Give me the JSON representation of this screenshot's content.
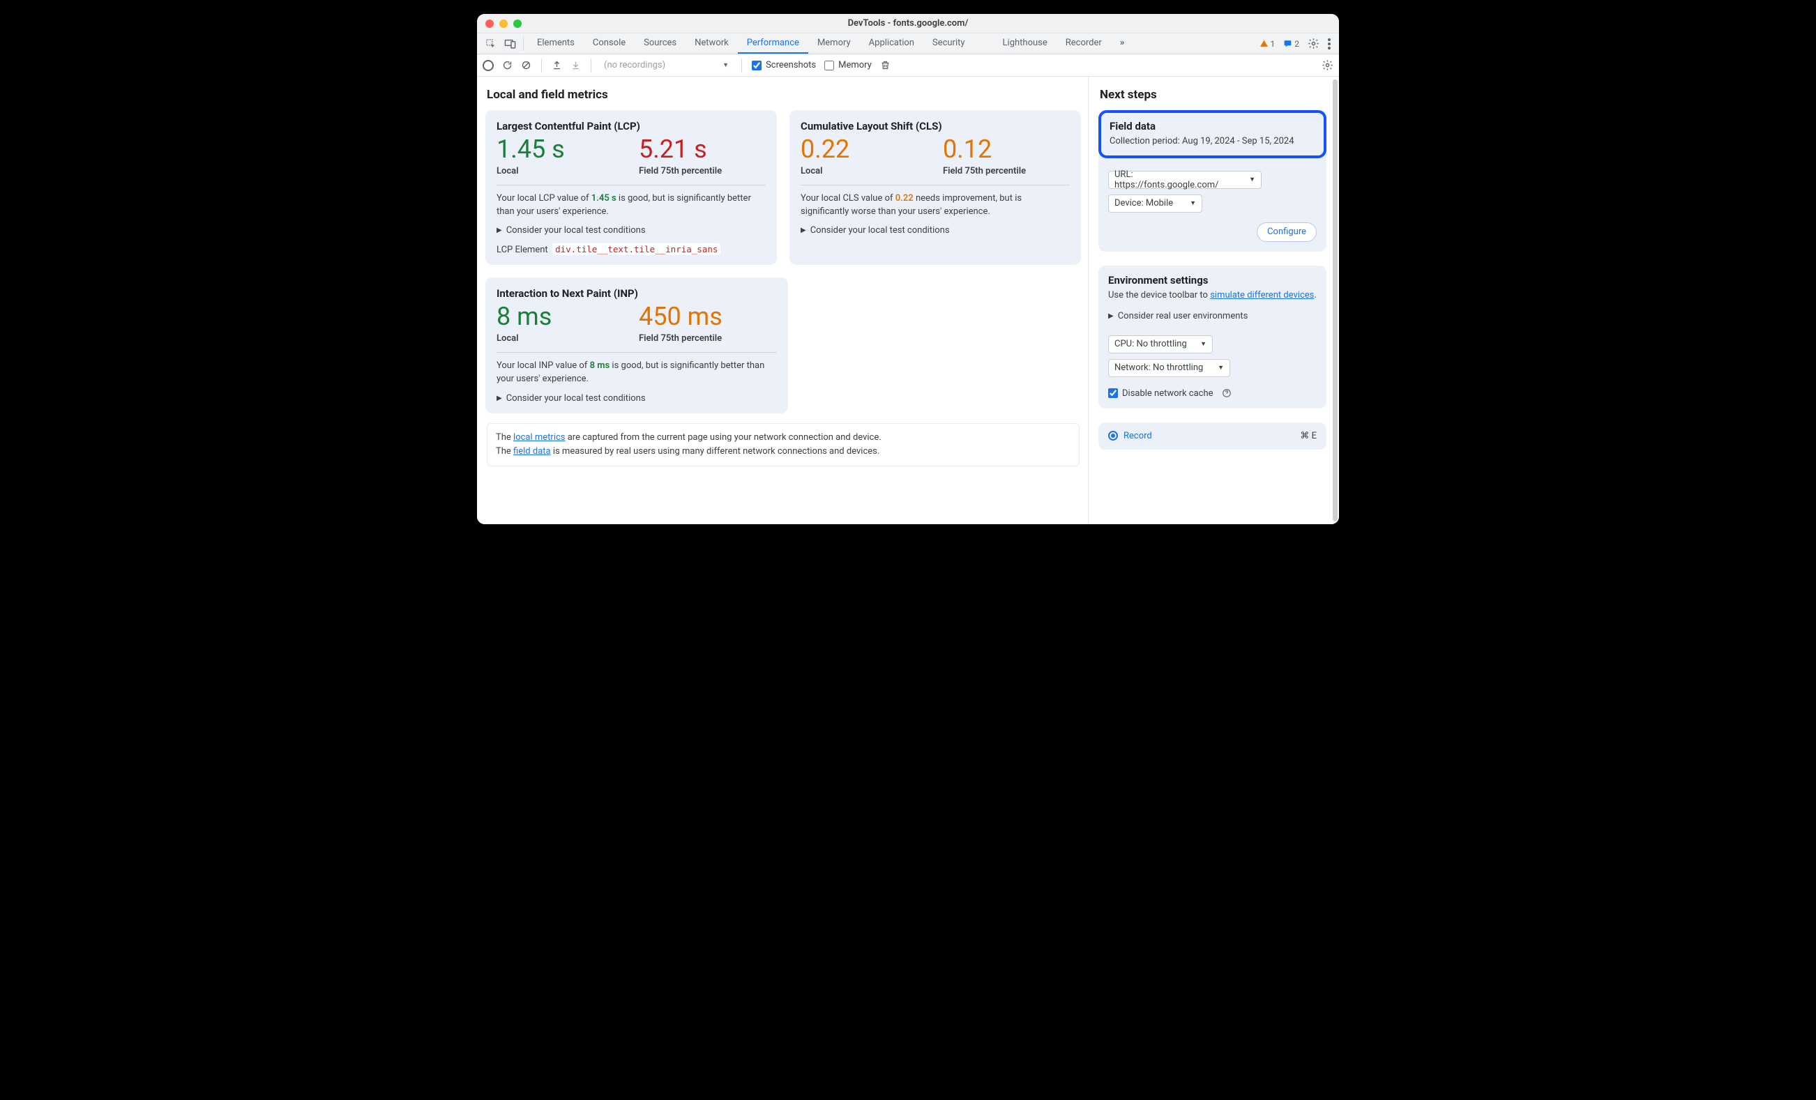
{
  "window": {
    "title": "DevTools - fonts.google.com/"
  },
  "tabs": {
    "items": [
      "Elements",
      "Console",
      "Sources",
      "Network",
      "Performance",
      "Memory",
      "Application",
      "Security",
      "Lighthouse",
      "Recorder"
    ],
    "active": 4
  },
  "status": {
    "warnings": "1",
    "messages": "2"
  },
  "subtoolbar": {
    "recordings_placeholder": "(no recordings)",
    "screenshots_label": "Screenshots",
    "screenshots_checked": true,
    "memory_label": "Memory",
    "memory_checked": false
  },
  "main": {
    "heading": "Local and field metrics",
    "lcp": {
      "title": "Largest Contentful Paint (LCP)",
      "local_value": "1.45 s",
      "local_label": "Local",
      "local_color": "green",
      "field_value": "5.21 s",
      "field_label": "Field 75th percentile",
      "field_color": "red",
      "desc_pre": "Your local LCP value of ",
      "desc_val": "1.45 s",
      "desc_post": " is good, but is significantly better than your users' experience.",
      "collapse": "Consider your local test conditions",
      "el_label": "LCP Element",
      "el_selector": "div.tile__text.tile__inria_sans"
    },
    "cls": {
      "title": "Cumulative Layout Shift (CLS)",
      "local_value": "0.22",
      "local_label": "Local",
      "local_color": "orange",
      "field_value": "0.12",
      "field_label": "Field 75th percentile",
      "field_color": "orange",
      "desc_pre": "Your local CLS value of ",
      "desc_val": "0.22",
      "desc_post": " needs improvement, but is significantly worse than your users' experience.",
      "collapse": "Consider your local test conditions"
    },
    "inp": {
      "title": "Interaction to Next Paint (INP)",
      "local_value": "8 ms",
      "local_label": "Local",
      "local_color": "green",
      "field_value": "450 ms",
      "field_label": "Field 75th percentile",
      "field_color": "orange",
      "desc_pre": "Your local INP value of ",
      "desc_val": "8 ms",
      "desc_post": " is good, but is significantly better than your users' experience.",
      "collapse": "Consider your local test conditions"
    },
    "footer": {
      "line1a": "The ",
      "link1": "local metrics",
      "line1b": " are captured from the current page using your network connection and device.",
      "line2a": "The ",
      "link2": "field data",
      "line2b": " is measured by real users using many different network connections and devices."
    }
  },
  "sidebar": {
    "heading": "Next steps",
    "field": {
      "title": "Field data",
      "period": "Collection period: Aug 19, 2024 - Sep 15, 2024",
      "url_select": "URL: https://fonts.google.com/",
      "device_select": "Device: Mobile",
      "configure": "Configure"
    },
    "env": {
      "title": "Environment settings",
      "text_pre": "Use the device toolbar to ",
      "link": "simulate different devices",
      "text_post": ".",
      "collapse": "Consider real user environments",
      "cpu_select": "CPU: No throttling",
      "net_select": "Network: No throttling",
      "cache_label": "Disable network cache",
      "cache_checked": true
    },
    "record": {
      "label": "Record",
      "shortcut": "⌘ E"
    }
  }
}
